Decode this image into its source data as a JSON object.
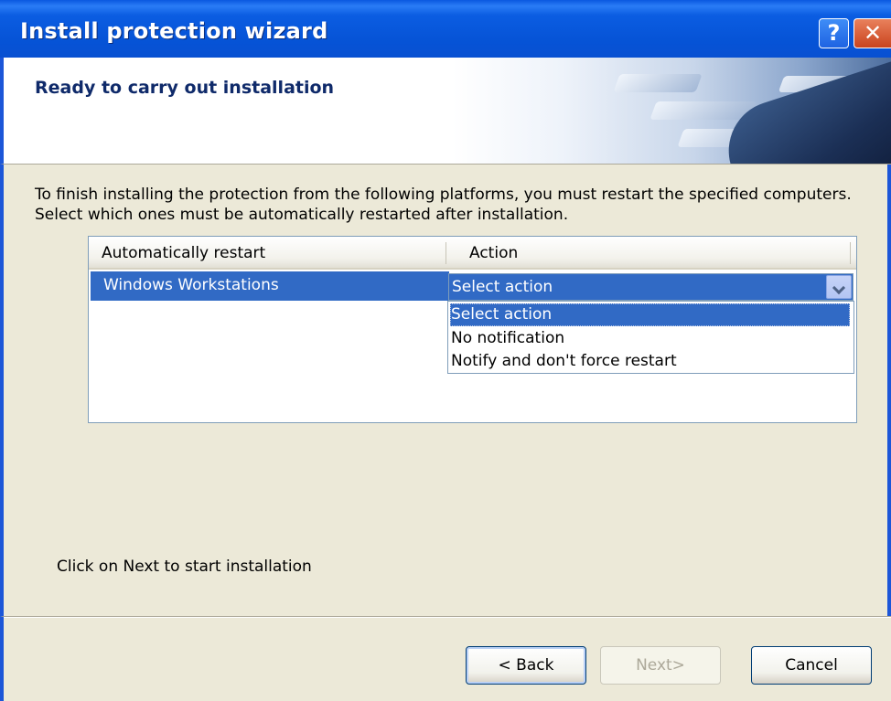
{
  "window": {
    "title": "Install protection wizard",
    "help_label": "?",
    "close_label": "✕"
  },
  "header": {
    "title": "Ready to carry out installation"
  },
  "content": {
    "intro": "To finish installing the protection from the following platforms, you must restart the specified computers. Select which ones must be automatically restarted after installation.",
    "listview": {
      "columns": [
        "Automatically restart",
        "Action"
      ],
      "rows": [
        {
          "platform": "Windows Workstations",
          "action": "Select action"
        }
      ],
      "dropdown_options": [
        "Select action",
        "No notification",
        "Notify and don't force restart"
      ]
    },
    "footer_note": "Click on Next to start installation"
  },
  "buttons": {
    "back": "< Back",
    "next": "Next>",
    "cancel": "Cancel"
  },
  "colors": {
    "selection": "#316ac5",
    "titlebar": "#0a58e0",
    "panel": "#ece9d8"
  },
  "icons": {
    "help": "help-icon",
    "close": "close-icon",
    "dropdown": "chevron-down-icon"
  }
}
